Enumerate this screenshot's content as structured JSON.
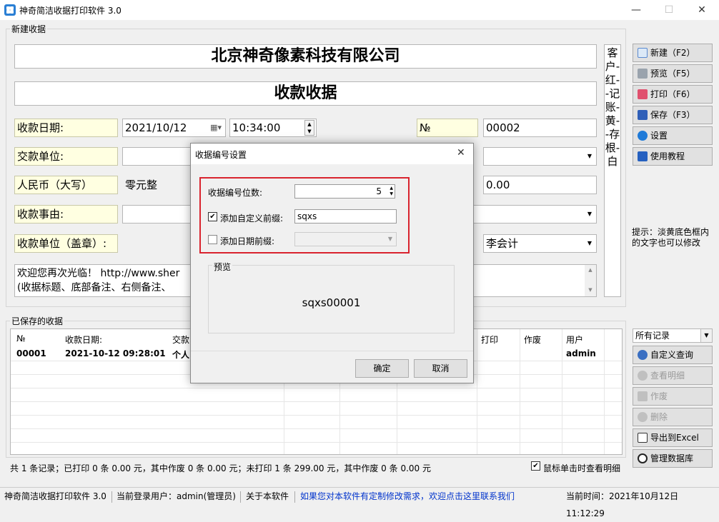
{
  "window": {
    "title": "神奇简洁收据打印软件 3.0"
  },
  "new_receipt": {
    "group_label": "新建收据",
    "company": "北京神奇像素科技有限公司",
    "doc_title": "收款收据",
    "labels": {
      "date": "收款日期:",
      "payer": "交款单位:",
      "rmb": "人民币（大写）",
      "reason": "收款事由:",
      "stamp": "收款单位（盖章）:",
      "no": "№"
    },
    "date_value": "2021/10/12",
    "time_value": "10:34:00",
    "no_value": "00002",
    "rmb_value": "零元整",
    "amount_value": "0.00",
    "accountant": "李会计",
    "note_line1": "欢迎您再次光临！ http://www.sher",
    "note_line2": "(收据标题、底部备注、右侧备注、",
    "side_text": "客户-红--记账-黄--存根-白"
  },
  "toolbar": {
    "new": "新建（F2）",
    "preview": "预览（F5）",
    "print": "打印（F6）",
    "save": "保存（F3）",
    "settings": "设置",
    "tutorial": "使用教程",
    "hint": "提示：淡黄底色框内的文字也可以修改"
  },
  "saved": {
    "group_label": "已保存的收据",
    "columns": [
      "№",
      "收款日期:",
      "交款",
      "打印",
      "作废",
      "用户"
    ],
    "rows": [
      {
        "no": "00001",
        "date": "2021-10-12 09:28:01",
        "payer": "个人",
        "user": "admin"
      }
    ],
    "filter": "所有记录",
    "summary": "共 1 条记录；已打印 0 条 0.00 元，其中作废 0 条 0.00 元；未打印 1 条 299.00 元，其中作废 0 条 0.00 元",
    "click_detail": "鼠标单击时查看明细"
  },
  "side_actions": {
    "custom_query": "自定义查询",
    "view_detail": "查看明细",
    "void": "作废",
    "delete": "删除",
    "export": "导出到Excel",
    "manage_db": "管理数据库"
  },
  "dialog": {
    "title": "收据编号设置",
    "digits_label": "收据编号位数:",
    "digits_value": "5",
    "prefix_label": "添加自定义前缀:",
    "prefix_value": "sqxs",
    "date_prefix_label": "添加日期前缀:",
    "preview_label": "预览",
    "preview_value": "sqxs00001",
    "ok": "确定",
    "cancel": "取消"
  },
  "status": {
    "app": "神奇简洁收据打印软件 3.0",
    "user": "当前登录用户：admin(管理员)",
    "about": "关于本软件",
    "link": "如果您对本软件有定制修改需求，欢迎点击这里联系我们",
    "time": "当前时间：2021年10月12日  11:12:29"
  },
  "colors": {
    "accent": "#2a7fd4",
    "highlight_border": "#d9232e",
    "label_bg": "#ffffe1",
    "link": "#0033cc"
  }
}
